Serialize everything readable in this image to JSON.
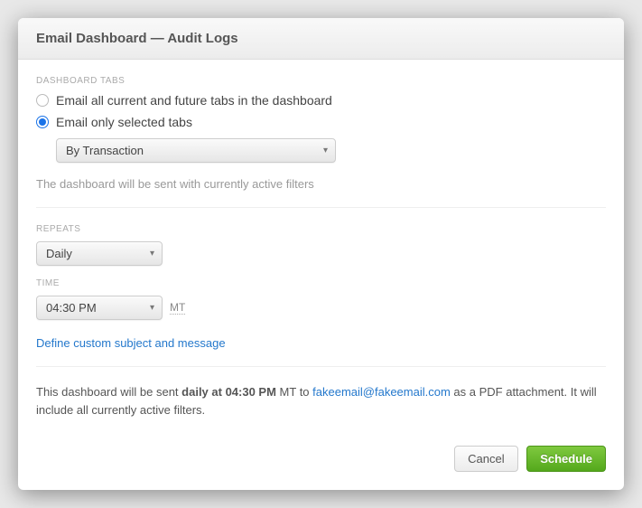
{
  "header": {
    "title": "Email Dashboard — Audit Logs"
  },
  "tabs": {
    "section_label": "DASHBOARD TABS",
    "option_all": "Email all current and future tabs in the dashboard",
    "option_selected": "Email only selected tabs",
    "selected_tab": "By Transaction",
    "hint": "The dashboard will be sent with currently active filters"
  },
  "repeats": {
    "section_label": "REPEATS",
    "value": "Daily"
  },
  "time": {
    "section_label": "TIME",
    "value": "04:30 PM",
    "tz": "MT"
  },
  "custom_link": "Define custom subject and message",
  "summary": {
    "pre": "This dashboard will be sent ",
    "bold": "daily at 04:30 PM",
    "mid": " MT to ",
    "email": "fakeemail@fakeemail.com",
    "post": " as a PDF attachment. It will include all currently active filters."
  },
  "footer": {
    "cancel": "Cancel",
    "schedule": "Schedule"
  }
}
